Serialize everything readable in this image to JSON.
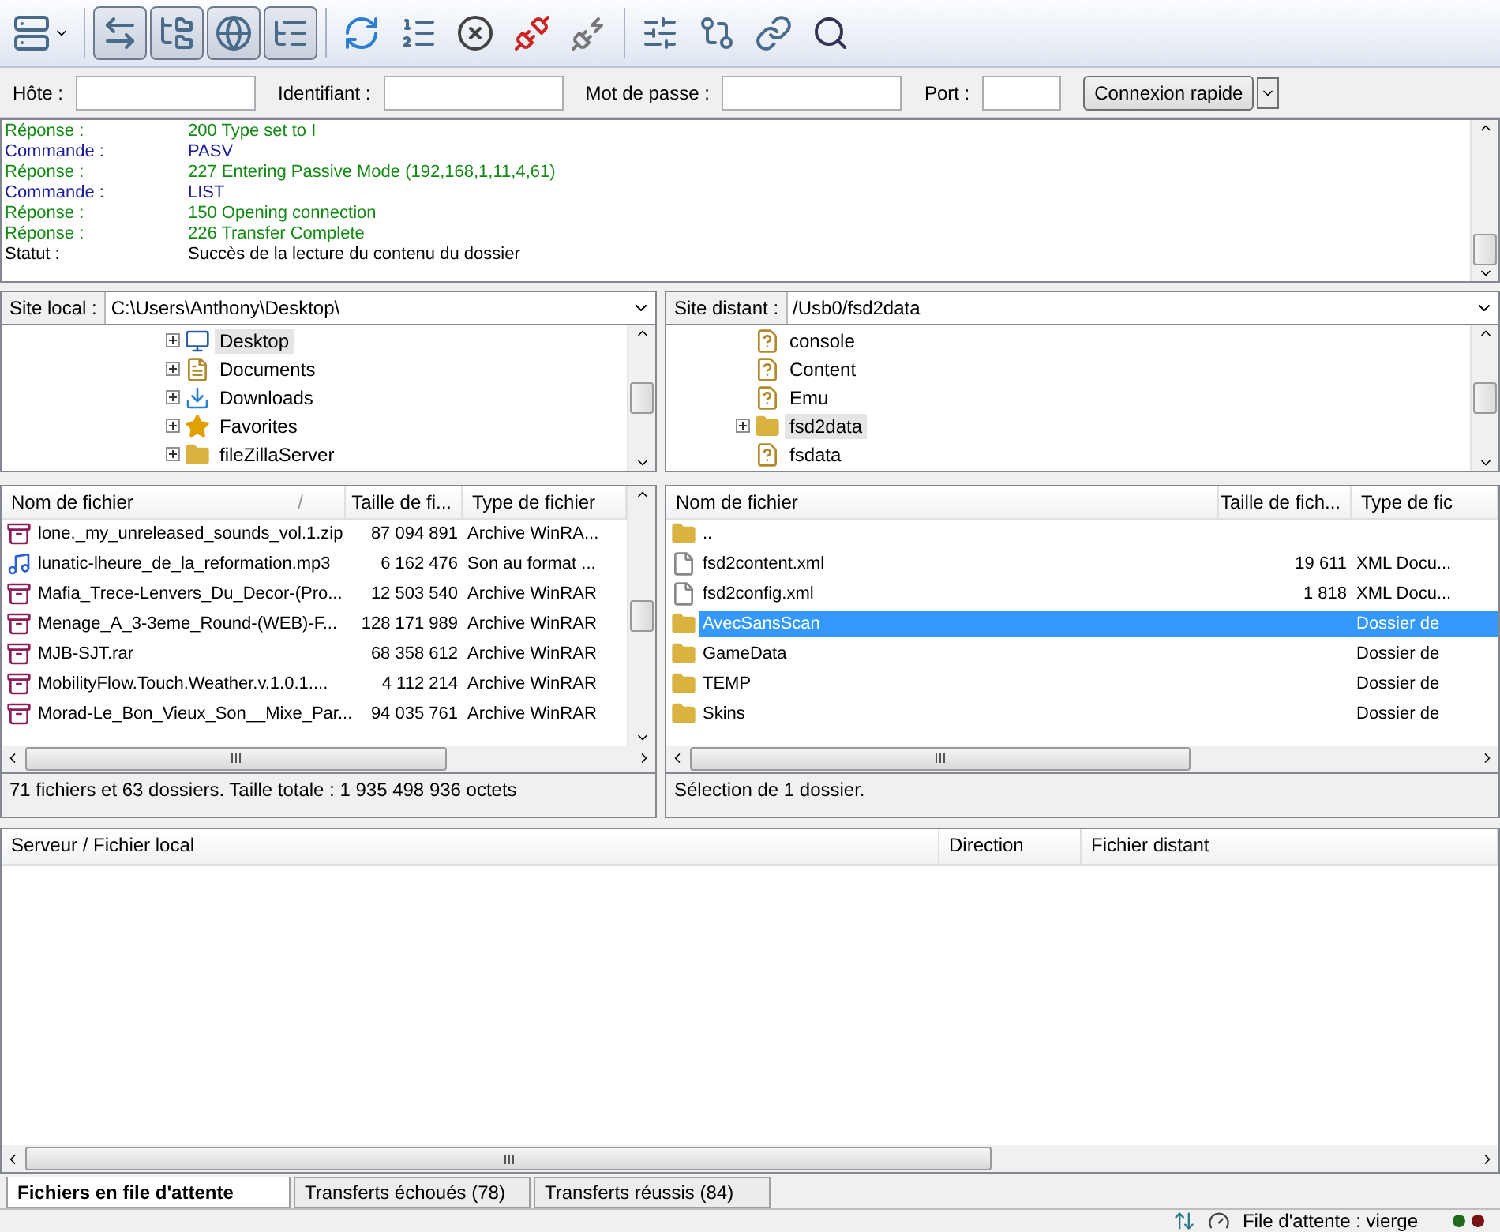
{
  "toolbar": [
    {
      "kind": "site-manager",
      "pressed": false,
      "dropdown": true
    },
    {
      "kind": "log",
      "pressed": true,
      "dropdown": false
    },
    {
      "kind": "local-tree",
      "pressed": true,
      "dropdown": false
    },
    {
      "kind": "remote-tree",
      "pressed": true,
      "dropdown": false
    },
    {
      "kind": "queue",
      "pressed": true,
      "dropdown": false
    },
    {
      "kind": "refresh",
      "pressed": false,
      "dropdown": false
    },
    {
      "kind": "process-queue",
      "pressed": false,
      "dropdown": false
    },
    {
      "kind": "cancel",
      "pressed": false,
      "dropdown": false
    },
    {
      "kind": "disconnect",
      "pressed": false,
      "dropdown": false
    },
    {
      "kind": "reconnect",
      "pressed": false,
      "dropdown": false
    },
    {
      "kind": "filter",
      "pressed": false,
      "dropdown": false
    },
    {
      "kind": "compare",
      "pressed": false,
      "dropdown": false
    },
    {
      "kind": "sync",
      "pressed": false,
      "dropdown": false
    },
    {
      "kind": "search",
      "pressed": false,
      "dropdown": false
    }
  ],
  "quickconnect": {
    "fields": [
      {
        "label": "Hôte :",
        "kind": "wide"
      },
      {
        "label": "Identifiant :",
        "kind": "wide"
      },
      {
        "label": "Mot de passe :",
        "kind": "wide"
      },
      {
        "label": "Port :",
        "kind": "narrow"
      }
    ],
    "button": "Connexion rapide"
  },
  "log": [
    {
      "kind": "response",
      "label": "Réponse :",
      "text": "200 Type set to I"
    },
    {
      "kind": "command",
      "label": "Commande :",
      "text": "PASV"
    },
    {
      "kind": "response",
      "label": "Réponse :",
      "text": "227 Entering Passive Mode (192,168,1,11,4,61)"
    },
    {
      "kind": "command",
      "label": "Commande :",
      "text": "LIST"
    },
    {
      "kind": "response",
      "label": "Réponse :",
      "text": "150 Opening connection"
    },
    {
      "kind": "response",
      "label": "Réponse :",
      "text": "226 Transfer Complete"
    },
    {
      "kind": "status",
      "label": "Statut :",
      "text": "Succès de la lecture du contenu du dossier"
    }
  ],
  "local": {
    "site_label": "Site local :",
    "path": "C:\\Users\\Anthony\\Desktop\\",
    "tree": [
      {
        "name": "Desktop",
        "kind": "desktop",
        "expandable": true,
        "selected": true
      },
      {
        "name": "Documents",
        "kind": "documents",
        "expandable": true,
        "selected": false
      },
      {
        "name": "Downloads",
        "kind": "downloads",
        "expandable": true,
        "selected": false
      },
      {
        "name": "Favorites",
        "kind": "favorites",
        "expandable": true,
        "selected": false
      },
      {
        "name": "fileZillaServer",
        "kind": "folder",
        "expandable": true,
        "selected": false
      }
    ],
    "columns": [
      "Nom de fichier",
      "Taille de fi...",
      "Type de fichier"
    ],
    "sort_mark": "/",
    "files": [
      {
        "kind": "archive",
        "name": "lone._my_unreleased_sounds_vol.1.zip",
        "size": "87 094 891",
        "type": "Archive WinRA...",
        "selected": false
      },
      {
        "kind": "audio",
        "name": "lunatic-lheure_de_la_reformation.mp3",
        "size": "6 162 476",
        "type": "Son au format ...",
        "selected": false
      },
      {
        "kind": "archive",
        "name": "Mafia_Trece-Lenvers_Du_Decor-(Pro...",
        "size": "12 503 540",
        "type": "Archive WinRAR",
        "selected": false
      },
      {
        "kind": "archive",
        "name": "Menage_A_3-3eme_Round-(WEB)-F...",
        "size": "128 171 989",
        "type": "Archive WinRAR",
        "selected": false
      },
      {
        "kind": "archive",
        "name": "MJB-SJT.rar",
        "size": "68 358 612",
        "type": "Archive WinRAR",
        "selected": false
      },
      {
        "kind": "archive",
        "name": "MobilityFlow.Touch.Weather.v.1.0.1....",
        "size": "4 112 214",
        "type": "Archive WinRAR",
        "selected": false
      },
      {
        "kind": "archive",
        "name": "Morad-Le_Bon_Vieux_Son__Mixe_Par...",
        "size": "94 035 761",
        "type": "Archive WinRAR",
        "selected": false
      }
    ],
    "status": "71 fichiers et 63 dossiers. Taille totale : 1 935 498 936 octets"
  },
  "remote": {
    "site_label": "Site distant :",
    "path": "/Usb0/fsd2data",
    "tree": [
      {
        "name": "console",
        "kind": "unknown",
        "expandable": false,
        "selected": false
      },
      {
        "name": "Content",
        "kind": "unknown",
        "expandable": false,
        "selected": false
      },
      {
        "name": "Emu",
        "kind": "unknown",
        "expandable": false,
        "selected": false
      },
      {
        "name": "fsd2data",
        "kind": "folder",
        "expandable": true,
        "selected": true
      },
      {
        "name": "fsdata",
        "kind": "unknown",
        "expandable": false,
        "selected": false
      }
    ],
    "columns": [
      "Nom de fichier",
      "Taille de fich...",
      "Type de fic"
    ],
    "files": [
      {
        "kind": "folder",
        "name": "..",
        "selected": false
      },
      {
        "kind": "document",
        "name": "fsd2content.xml",
        "size": "19 611",
        "type": "XML Docu...",
        "selected": false
      },
      {
        "kind": "document",
        "name": "fsd2config.xml",
        "size": "1 818",
        "type": "XML Docu...",
        "selected": false
      },
      {
        "kind": "folder",
        "name": "AvecSansScan",
        "type": "Dossier de",
        "selected": true
      },
      {
        "kind": "folder",
        "name": "GameData",
        "type": "Dossier de",
        "selected": false
      },
      {
        "kind": "folder",
        "name": "TEMP",
        "type": "Dossier de",
        "selected": false
      },
      {
        "kind": "folder",
        "name": "Skins",
        "type": "Dossier de",
        "selected": false
      }
    ],
    "status": "Sélection de 1 dossier."
  },
  "queue": {
    "columns": [
      "Serveur / Fichier local",
      "Direction",
      "Fichier distant"
    ],
    "tabs": [
      {
        "label": "Fichiers en file d'attente",
        "selected": true
      },
      {
        "label": "Transferts échoués (78)",
        "selected": false
      },
      {
        "label": "Transferts réussis (84)",
        "selected": false
      }
    ]
  },
  "status_bar": {
    "queue": "File d'attente : vierge",
    "lights": [
      {
        "color": "#1e6b1e"
      },
      {
        "color": "#7a1414"
      }
    ]
  }
}
